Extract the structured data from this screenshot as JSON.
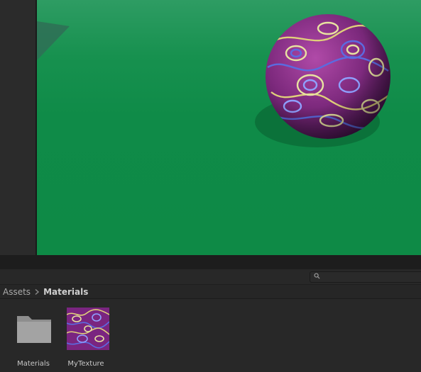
{
  "breadcrumb": {
    "root": "Assets",
    "current": "Materials"
  },
  "search": {
    "placeholder": ""
  },
  "assets": [
    {
      "label": "Materials",
      "type": "folder",
      "icon": "folder-icon"
    },
    {
      "label": "MyTexture",
      "type": "texture",
      "icon": "texture-thumbnail"
    }
  ],
  "colors": {
    "ground": "#0e8a46",
    "sphere": "#8a2a8a",
    "panel": "#282828"
  }
}
